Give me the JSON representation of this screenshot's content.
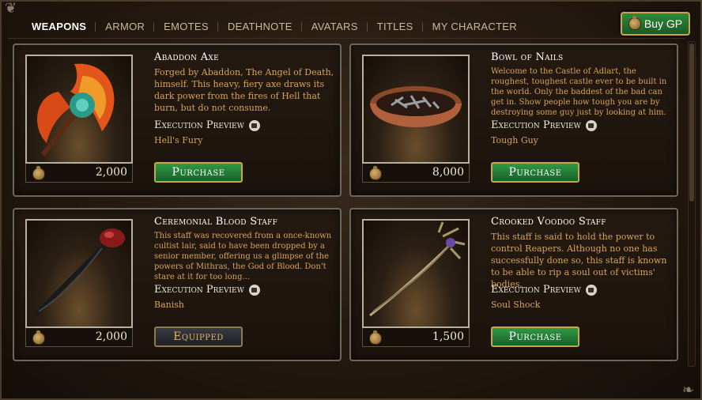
{
  "tabs": [
    {
      "label": "WEAPONS",
      "active": true
    },
    {
      "label": "ARMOR",
      "active": false
    },
    {
      "label": "EMOTES",
      "active": false
    },
    {
      "label": "DEATHNOTE",
      "active": false
    },
    {
      "label": "AVATARS",
      "active": false
    },
    {
      "label": "TITLES",
      "active": false
    },
    {
      "label": "MY CHARACTER",
      "active": false
    }
  ],
  "buy_gp_label": "Buy GP",
  "items": [
    {
      "title": "Abaddon Axe",
      "description": "Forged by Abaddon, The Angel of Death, himself. This heavy, fiery axe draws its dark power from the fires of Hell that burn, but do not consume.",
      "execution_preview_label": "Execution Preview",
      "execution_name": "Hell's Fury",
      "price": "2,000",
      "button_label": "Purchase",
      "state": "purchase"
    },
    {
      "title": "Bowl of Nails",
      "description": "Welcome to the Castle of Adlart, the roughest, toughest castle ever to be built in the world. Only the baddest of the bad can get in. Show people how tough you are by destroying some guy just by looking at him.",
      "execution_preview_label": "Execution Preview",
      "execution_name": "Tough Guy",
      "price": "8,000",
      "button_label": "Purchase",
      "state": "purchase"
    },
    {
      "title": "Ceremonial Blood Staff",
      "description": "This staff was recovered from a once-known cultist lair, said to have been dropped by a senior member, offering us a glimpse of the powers of Mithras, the God of Blood. Don't stare at it for too long...",
      "execution_preview_label": "Execution Preview",
      "execution_name": "Banish",
      "price": "2,000",
      "button_label": "Equipped",
      "state": "equipped"
    },
    {
      "title": "Crooked Voodoo Staff",
      "description": "This staff is said to hold the power to control Reapers. Although no one has successfully done so, this staff is known to be able to rip a soul out of victims' bodies.",
      "execution_preview_label": "Execution Preview",
      "execution_name": "Soul Shock",
      "price": "1,500",
      "button_label": "Purchase",
      "state": "purchase"
    }
  ],
  "icons": {
    "currency": "coin-bag-icon",
    "preview": "camera-icon"
  },
  "colors": {
    "accent_gold": "#c9a64a",
    "purchase_green": "#2f9a44",
    "description_orange": "#d8a25a"
  }
}
